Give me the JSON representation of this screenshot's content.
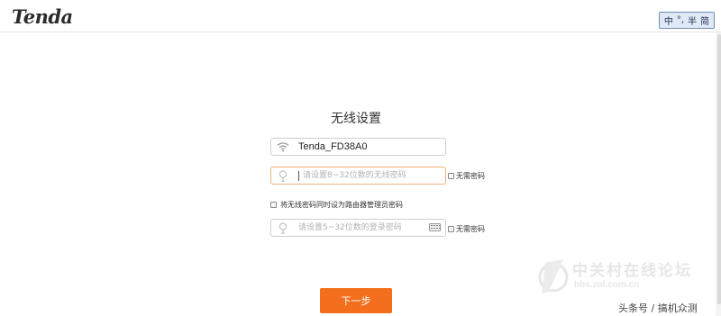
{
  "header": {
    "logo": "Tenda",
    "ime": {
      "lang": "中",
      "punct": "°,",
      "width": "半",
      "script": "简"
    }
  },
  "wizard": {
    "title": "无线设置",
    "ssid": {
      "icon": "wifi-icon",
      "value": "Tenda_FD38A0"
    },
    "wifi_password": {
      "icon": "lock-icon",
      "placeholder": "请设置8~32位数的无线密码",
      "no_password_label": "无需密码"
    },
    "sync_option": {
      "label": "将无线密码同时设为路由器管理员密码"
    },
    "login_password": {
      "icon": "lock-icon",
      "placeholder": "请设置5~32位数的登录密码",
      "no_password_label": "无需密码"
    },
    "next_label": "下一步"
  },
  "watermark": {
    "brand_cn": "中关村在线论坛",
    "url": "bbs.zol.com.cn",
    "credit": "头条号 / 搞机众测"
  },
  "colors": {
    "accent": "#f36f1e",
    "focus_border": "#f0b27a"
  }
}
